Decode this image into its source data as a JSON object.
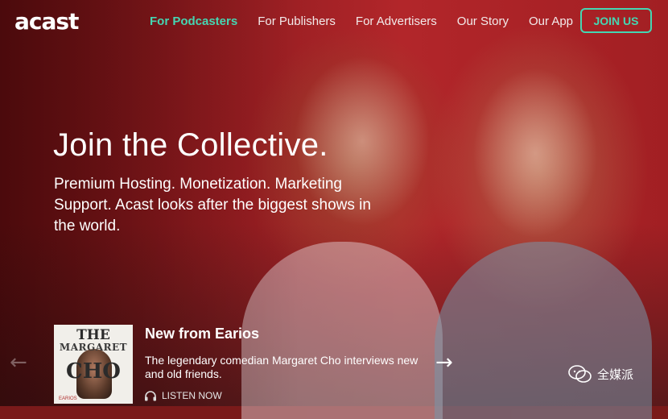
{
  "logo": "acast",
  "nav": {
    "items": [
      {
        "label": "For Podcasters",
        "active": true
      },
      {
        "label": "For Publishers",
        "active": false
      },
      {
        "label": "For Advertisers",
        "active": false
      },
      {
        "label": "Our Story",
        "active": false
      },
      {
        "label": "Our App",
        "active": false
      }
    ],
    "join_label": "JOIN US"
  },
  "hero": {
    "headline": "Join the Collective.",
    "subtext": "Premium Hosting. Monetization. Marketing Support. Acast looks after the biggest shows in the world."
  },
  "featured": {
    "title": "New from Earios",
    "description": "The legendary comedian Margaret Cho interviews new and old friends.",
    "listen_label": "LISTEN NOW",
    "cover": {
      "line1": "THE",
      "line2": "MARGARET",
      "line3": "CHO",
      "brand": "EARIOS"
    }
  },
  "colors": {
    "accent": "#45d6b2",
    "hero_red": "#b2262a"
  },
  "icons": {
    "prev": "arrow-left-icon",
    "next": "arrow-right-icon",
    "listen": "headphones-icon"
  },
  "watermark": "全媒派"
}
